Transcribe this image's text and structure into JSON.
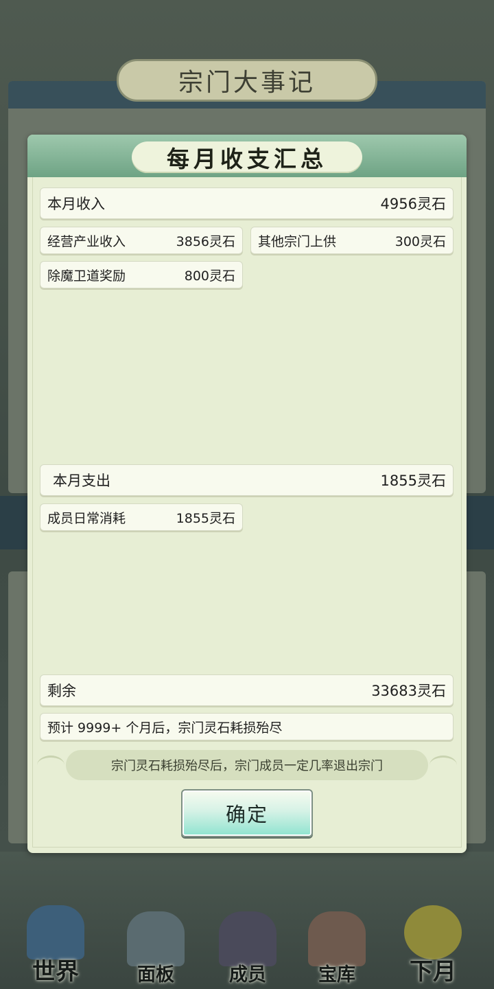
{
  "background": {
    "panel_title": "宗门大事记",
    "nav": [
      {
        "label": "世界",
        "icon": "world-pavilion-icon",
        "color": "#3d5f7a"
      },
      {
        "label": "面板",
        "icon": "panel-gate-icon",
        "color": "#5a6b70"
      },
      {
        "label": "成员",
        "icon": "member-portrait-icon",
        "color": "#4a4a5a"
      },
      {
        "label": "宝库",
        "icon": "treasury-tower-icon",
        "color": "#6e5a4e"
      },
      {
        "label": "下月",
        "icon": "crescent-moon-icon",
        "color": "#8f8a3a"
      }
    ]
  },
  "modal": {
    "title": "每月收支汇总",
    "income": {
      "label": "本月收入",
      "value": "4956灵石",
      "items": [
        {
          "label": "经营产业收入",
          "value": "3856灵石"
        },
        {
          "label": "其他宗门上供",
          "value": "300灵石"
        },
        {
          "label": "除魔卫道奖励",
          "value": "800灵石"
        }
      ]
    },
    "expense": {
      "label": "本月支出",
      "value": "1855灵石",
      "items": [
        {
          "label": "成员日常消耗",
          "value": "1855灵石"
        }
      ]
    },
    "remaining": {
      "label": "剩余",
      "value": "33683灵石"
    },
    "forecast": "预计 9999+ 个月后，宗门灵石耗损殆尽",
    "warning": "宗门灵石耗损殆尽后，宗门成员一定几率退出宗门",
    "confirm_label": "确定"
  },
  "colors": {
    "modal_bg": "#e7eed4",
    "header_green": "#6ea384",
    "button_teal": "#8ee3cf"
  }
}
